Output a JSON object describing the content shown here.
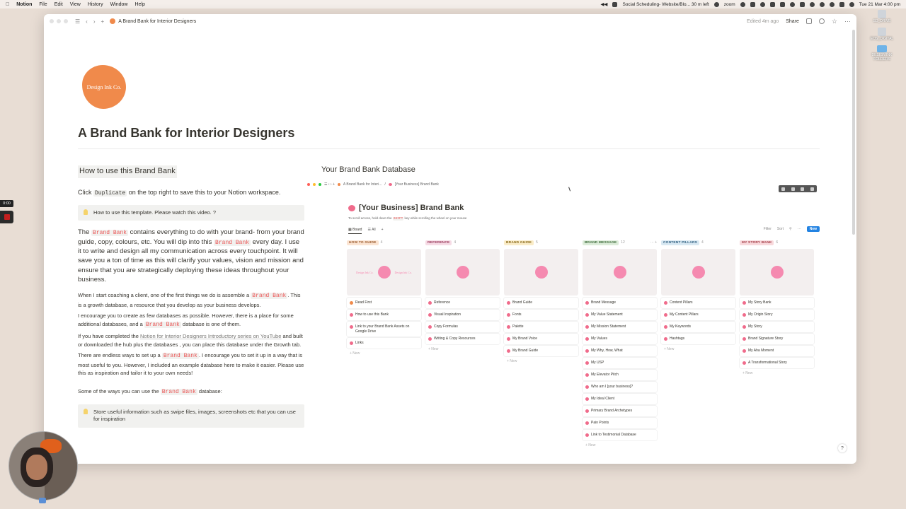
{
  "menubar": {
    "app": "Notion",
    "menus": [
      "File",
      "Edit",
      "View",
      "History",
      "Window",
      "Help"
    ],
    "status_text": "Social Scheduling- Website/Blo... 30 m left",
    "zoom_label": "zoom",
    "datetime": "Tue 21 Mar  4:00 pm"
  },
  "desktop": {
    "items": [
      "SD_DRIVE",
      "EOS_DIGITAL",
      "DESIGN INK FOLDERS"
    ]
  },
  "topbar": {
    "breadcrumb": "A Brand Bank for Interior Designers",
    "edited": "Edited 4m ago",
    "share": "Share"
  },
  "page": {
    "logo_text": "Design Ink Co.",
    "title": "A Brand Bank for Interior Designers"
  },
  "left": {
    "heading": "How to use this Brand Bank",
    "p1_pre": "Click ",
    "p1_code": "Duplicate",
    "p1_post": " on the top right to save this to your Notion workspace.",
    "callout1": "How to use this template. Please watch this video. ?",
    "p2_pre": "The ",
    "p2_code1": "Brand Bank",
    "p2_mid": " contains everything to do with your brand- from your brand guide, copy, colours, etc.  You will dip into this ",
    "p2_code2": "Brand Bank",
    "p2_post": " every day.   I use it to write and design all my communication across every touchpoint.  It will save you a ton of time as this will clarify your values, vision and mission and ensure that you are strategically deploying these ideas throughout your business.",
    "s1_pre": "When I start coaching a client, one of the first things we do is assemble a ",
    "s1_code": "Brand Bank",
    "s1_post": ".  This is a growth database, a resource that you develop as your business develops.",
    "s2_pre": "I encourage you to create as few databases as possible.  However, there is a place for some additional databases, and a ",
    "s2_code": "Brand Bank",
    "s2_post": " database is one of them.",
    "s3_pre": "If you have completed the ",
    "s3_link": "Notion for Interior Designers Introductory series on YouTube",
    "s3_post": " and built or downloaded the hub plus the databases , you can place this database under the Growth tab.",
    "s4_pre": "There are endless ways to set up a ",
    "s4_code": "Brand Bank",
    "s4_post": ". I encourage you to set it up in a way that is most useful to you.   However, I included an example database here to make it easier.  Please use this as inspiration and tailor it to your own needs!",
    "s5_pre": "Some of the ways you can use the ",
    "s5_code": "Brand Bank",
    "s5_post": " database:",
    "callout2": "Store useful information such as swipe files, images, screenshots etc that you can use for inspiration"
  },
  "right": {
    "heading": "Your Brand Bank Database",
    "embed_crumb1": "A Brand Bank for Interi...",
    "embed_crumb2": "[Your Business] Brand Bank",
    "db_title": "[Your Business] Brand Bank",
    "hint_pre": "To scroll across, hold down the ",
    "hint_code": "SHIFT",
    "hint_post": " key while scrolling the wheel on your mouse",
    "view_board": "Board",
    "view_all": "All",
    "filter": "Filter",
    "sort": "Sort",
    "new": "New",
    "new_row": "+ New"
  },
  "board": [
    {
      "label": "HOW TO GUIDE",
      "count": "4",
      "bg": "#fbe4d2",
      "fg": "#9a5a2d",
      "cover_text": "Design Ink Co.",
      "cards": [
        "Read First",
        "How to use this Bank",
        "Link to your Brand Bank Assets on Google Drive",
        "Links"
      ]
    },
    {
      "label": "REFERENCE",
      "count": "4",
      "bg": "#f6dbe5",
      "fg": "#9b3d5e",
      "cards": [
        "Reference",
        "Visual Inspiration",
        "Copy Formulas",
        "Writing & Copy Resources"
      ]
    },
    {
      "label": "BRAND GUIDE",
      "count": "5",
      "bg": "#faecc8",
      "fg": "#8a6a1a",
      "cards": [
        "Brand Guide",
        "Fonts",
        "Palette",
        "My Brand Voice",
        "My Brand Guide"
      ]
    },
    {
      "label": "BRAND MESSAGE",
      "count": "12",
      "bg": "#dcecd9",
      "fg": "#3d6b3a",
      "extra": "··· +",
      "cards": [
        "Brand Message",
        "My Value Statement",
        "My Mission Statement",
        "My Values",
        "My Why, How, What",
        "My USP",
        "My Elevator Pitch",
        "Who am I [your business]?",
        "My Ideal Client",
        "Primary Brand Archetypes",
        "Pain Points",
        "Link to Testimonial Database"
      ]
    },
    {
      "label": "CONTENT PILLARS",
      "count": "4",
      "bg": "#d8e8f2",
      "fg": "#2f5f80",
      "cards": [
        "Content Pillars",
        "My Content Pillars",
        "My Keywords",
        "Hashtags"
      ]
    },
    {
      "label": "MY STORY BANK",
      "count": "6",
      "bg": "#f8d9dc",
      "fg": "#a33a45",
      "cards": [
        "My Story Bank",
        "My Origin Story",
        "My Story",
        "Brand Signature Story",
        "My Aha Moment",
        "A Transformational Story"
      ]
    }
  ],
  "overlay": {
    "timer": "0:00"
  }
}
